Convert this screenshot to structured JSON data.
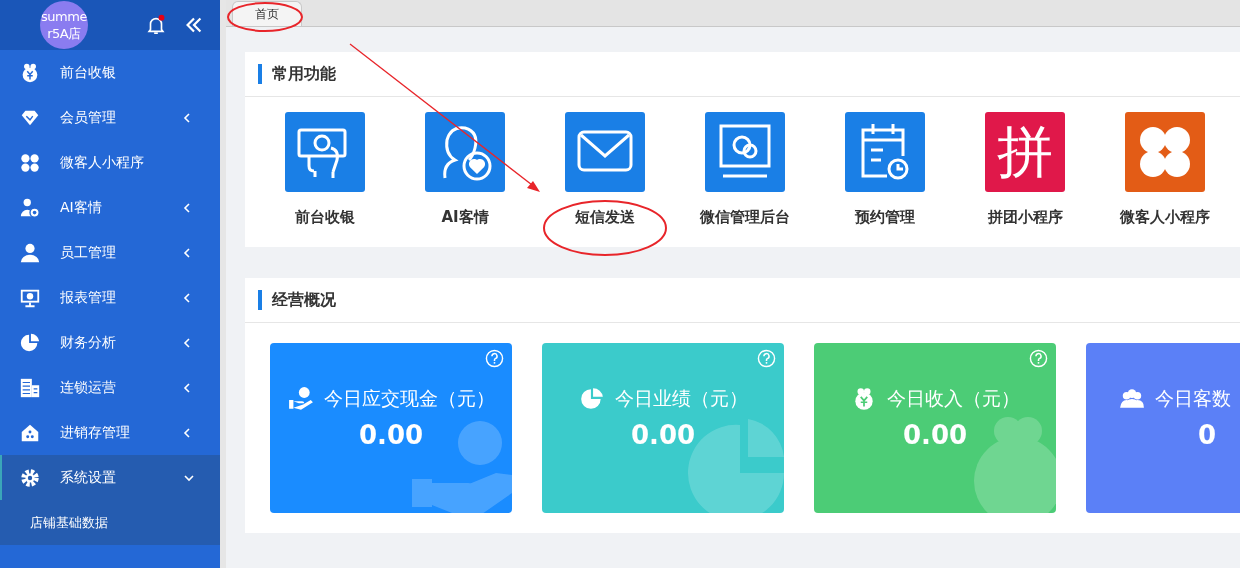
{
  "sidebar": {
    "store_name": "summer5A店",
    "notification": true,
    "items": [
      {
        "label": "前台收银",
        "selected": false
      },
      {
        "label": "会员管理",
        "selected": false,
        "expanded": false
      },
      {
        "label": "微客人小程序",
        "selected": false
      },
      {
        "label": "AI客情",
        "selected": false,
        "expanded": false
      },
      {
        "label": "员工管理",
        "selected": false,
        "expanded": false
      },
      {
        "label": "报表管理",
        "selected": false,
        "expanded": false
      },
      {
        "label": "财务分析",
        "selected": false,
        "expanded": false
      },
      {
        "label": "连锁运营",
        "selected": false,
        "expanded": false
      },
      {
        "label": "进销存管理",
        "selected": false,
        "expanded": false
      },
      {
        "label": "系统设置",
        "selected": true,
        "expanded": true,
        "children": [
          {
            "label": "店铺基础数据"
          }
        ]
      }
    ]
  },
  "tabs": [
    {
      "label": "首页",
      "selected": true
    }
  ],
  "common_functions": {
    "title": "常用功能",
    "items": [
      {
        "label": "前台收银",
        "color": "#1a7fe6"
      },
      {
        "label": "AI客情",
        "color": "#1a7fe6"
      },
      {
        "label": "短信发送",
        "color": "#1a7fe6"
      },
      {
        "label": "微信管理后台",
        "color": "#1a7fe6"
      },
      {
        "label": "预约管理",
        "color": "#1a7fe6"
      },
      {
        "label": "拼团小程序",
        "color": "#e0184a",
        "glyph": "拼"
      },
      {
        "label": "微客人小程序",
        "color": "#e35c16"
      }
    ]
  },
  "overview": {
    "title": "经营概况",
    "cards": [
      {
        "title": "今日应交现金（元）",
        "value": "0.00",
        "color": "#1a8cff",
        "help": true
      },
      {
        "title": "今日业绩（元）",
        "value": "0.00",
        "color": "#3bcbcb",
        "help": true
      },
      {
        "title": "今日收入（元）",
        "value": "0.00",
        "color": "#4ccc76",
        "help": true
      },
      {
        "title": "今日客数",
        "value": "0",
        "color": "#5b80f7",
        "help": false
      }
    ]
  }
}
